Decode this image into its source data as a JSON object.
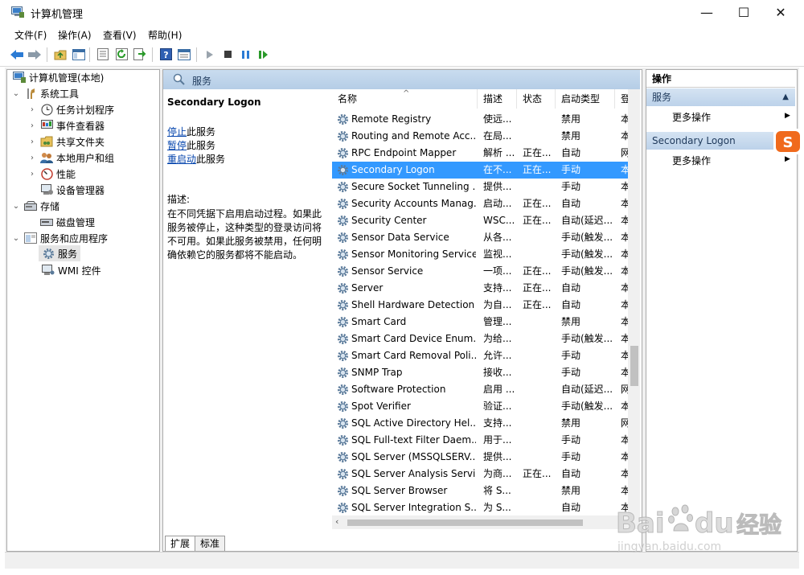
{
  "window": {
    "title": "计算机管理",
    "minimize": "—",
    "maximize": "☐",
    "close": "✕"
  },
  "menu": [
    {
      "label": "文件(F)"
    },
    {
      "label": "操作(A)"
    },
    {
      "label": "查看(V)"
    },
    {
      "label": "帮助(H)"
    }
  ],
  "toolbar": {
    "icons": [
      "back-icon",
      "forward-icon",
      "up-folder-icon",
      "show-hide-tree-icon",
      "properties-icon",
      "refresh-icon",
      "export-icon",
      "help-icon",
      "view-icon",
      "play-icon",
      "stop-icon",
      "pause-icon",
      "resume-icon"
    ]
  },
  "tree": {
    "root": "计算机管理(本地)",
    "system_tools": "系统工具",
    "task_scheduler": "任务计划程序",
    "event_viewer": "事件查看器",
    "shared_folders": "共享文件夹",
    "local_users": "本地用户和组",
    "performance": "性能",
    "device_manager": "设备管理器",
    "storage": "存储",
    "disk_management": "磁盘管理",
    "services_apps": "服务和应用程序",
    "services": "服务",
    "wmi": "WMI 控件"
  },
  "center": {
    "header": "服务",
    "selected_service": "Secondary Logon",
    "stop_link": "停止",
    "stop_suffix": "此服务",
    "pause_link": "暂停",
    "pause_suffix": "此服务",
    "restart_link": "重启动",
    "restart_suffix": "此服务",
    "desc_label": "描述:",
    "description": "在不同凭据下启用启动过程。如果此服务被停止，这种类型的登录访问将不可用。如果此服务被禁用，任何明确依赖它的服务都将不能启动。",
    "tabs": [
      "扩展",
      "标准"
    ]
  },
  "list": {
    "columns": [
      "名称",
      "描述",
      "状态",
      "启动类型",
      "登"
    ],
    "rows": [
      {
        "name": "Remote Registry",
        "desc": "使远...",
        "status": "",
        "startup": "禁用",
        "logon": "本"
      },
      {
        "name": "Routing and Remote Acc...",
        "desc": "在局...",
        "status": "",
        "startup": "禁用",
        "logon": "本"
      },
      {
        "name": "RPC Endpoint Mapper",
        "desc": "解析 ...",
        "status": "正在...",
        "startup": "自动",
        "logon": "网"
      },
      {
        "name": "Secondary Logon",
        "desc": "在不...",
        "status": "正在...",
        "startup": "手动",
        "logon": "本"
      },
      {
        "name": "Secure Socket Tunneling ...",
        "desc": "提供...",
        "status": "",
        "startup": "手动",
        "logon": "本"
      },
      {
        "name": "Security Accounts Manag...",
        "desc": "启动...",
        "status": "正在...",
        "startup": "自动",
        "logon": "本"
      },
      {
        "name": "Security Center",
        "desc": "WSC...",
        "status": "正在...",
        "startup": "自动(延迟...",
        "logon": "本"
      },
      {
        "name": "Sensor Data Service",
        "desc": "从各...",
        "status": "",
        "startup": "手动(触发...",
        "logon": "本"
      },
      {
        "name": "Sensor Monitoring Service",
        "desc": "监视...",
        "status": "",
        "startup": "手动(触发...",
        "logon": "本"
      },
      {
        "name": "Sensor Service",
        "desc": "一项...",
        "status": "正在...",
        "startup": "手动(触发...",
        "logon": "本"
      },
      {
        "name": "Server",
        "desc": "支持...",
        "status": "正在...",
        "startup": "自动",
        "logon": "本"
      },
      {
        "name": "Shell Hardware Detection",
        "desc": "为自...",
        "status": "正在...",
        "startup": "自动",
        "logon": "本"
      },
      {
        "name": "Smart Card",
        "desc": "管理...",
        "status": "",
        "startup": "禁用",
        "logon": "本"
      },
      {
        "name": "Smart Card Device Enum...",
        "desc": "为给...",
        "status": "",
        "startup": "手动(触发...",
        "logon": "本"
      },
      {
        "name": "Smart Card Removal Poli...",
        "desc": "允许...",
        "status": "",
        "startup": "手动",
        "logon": "本"
      },
      {
        "name": "SNMP Trap",
        "desc": "接收...",
        "status": "",
        "startup": "手动",
        "logon": "本"
      },
      {
        "name": "Software Protection",
        "desc": "启用 ...",
        "status": "",
        "startup": "自动(延迟...",
        "logon": "网"
      },
      {
        "name": "Spot Verifier",
        "desc": "验证...",
        "status": "",
        "startup": "手动(触发...",
        "logon": "本"
      },
      {
        "name": "SQL Active Directory Hel...",
        "desc": "支持...",
        "status": "",
        "startup": "禁用",
        "logon": "网"
      },
      {
        "name": "SQL Full-text Filter Daem...",
        "desc": "用于...",
        "status": "",
        "startup": "手动",
        "logon": "本"
      },
      {
        "name": "SQL Server (MSSQLSERV...",
        "desc": "提供...",
        "status": "",
        "startup": "手动",
        "logon": "本"
      },
      {
        "name": "SQL Server Analysis Servi...",
        "desc": "为商...",
        "status": "正在...",
        "startup": "自动",
        "logon": "本"
      },
      {
        "name": "SQL Server Browser",
        "desc": "将 S...",
        "status": "",
        "startup": "禁用",
        "logon": "本"
      },
      {
        "name": "SQL Server Integration S...",
        "desc": "为 S...",
        "status": "",
        "startup": "自动",
        "logon": "本"
      }
    ]
  },
  "actions": {
    "header": "操作",
    "section1": "服务",
    "more1": "更多操作",
    "section2": "Secondary Logon",
    "more2": "更多操作"
  },
  "watermark": {
    "brand": "Bai",
    "brand2": "du",
    "cn": "经验",
    "url": "jingyan.baidu.com"
  },
  "colors": {
    "selection": "#3399ff",
    "link": "#0645ad",
    "header_grad": "#c9dcef"
  }
}
